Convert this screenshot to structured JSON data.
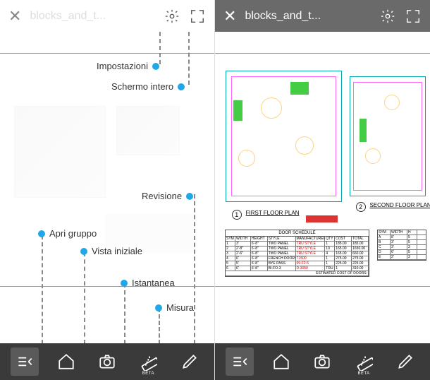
{
  "left": {
    "title": "blocks_and_t...",
    "callouts": {
      "settings": "Impostazioni",
      "fullscreen": "Schermo intero",
      "open_group": "Apri gruppo",
      "initial_view": "Vista iniziale",
      "snapshot": "Istantanea",
      "revision": "Revisione",
      "measure": "Misura"
    }
  },
  "right": {
    "title": "blocks_and_t...",
    "plans": {
      "first_num": "1",
      "first_label": "FIRST FLOOR PLAN",
      "second_num": "2",
      "second_label": "SECOND FLOOR PLAN"
    },
    "schedule": {
      "title": "DOOR SCHEDULE",
      "headers": [
        "SYM",
        "WIDTH",
        "HEIGHT",
        "STYLE",
        "MANUFACTURER",
        "QTY",
        "COST",
        "TOTAL"
      ],
      "rows": [
        [
          "1",
          "3'",
          "6'-8\"",
          "TWO PANEL",
          "TRU STYLE",
          "1",
          "185.00",
          "185.00"
        ],
        [
          "2",
          "2'-8\"",
          "6'-8\"",
          "TWO PANEL",
          "TRU STYLE",
          "10",
          "165.00",
          "1650.00"
        ],
        [
          "3",
          "2'-6\"",
          "6'-8\"",
          "TWO PANEL",
          "TRU STYLE",
          "4",
          "165.00",
          "660.00"
        ],
        [
          "4",
          "6'",
          "6'-8\"",
          "FRENCH DOORS",
          "T1500",
          "1",
          "275.00",
          "275.00"
        ],
        [
          "5",
          "5'",
          "6'-8\"",
          "BYE PASS",
          "69-F2-5",
          "1",
          "225.00",
          "225.00"
        ],
        [
          "6",
          "6'",
          "6'-8\"",
          "BI-FO-3",
          "D-3050",
          "TRU STYLE",
          "1",
          "310.00"
        ]
      ],
      "footer": "ESTIMATED COST OF DOORS:"
    },
    "schedule2": {
      "headers": [
        "SYM",
        "WIDTH",
        "H"
      ],
      "rows": [
        [
          "A",
          "8'",
          "5"
        ],
        [
          "B",
          "3'",
          "5"
        ],
        [
          "C",
          "3'",
          "3"
        ],
        [
          "D",
          "6'",
          "5"
        ],
        [
          "E",
          "2'",
          "3"
        ]
      ]
    }
  },
  "bottombar": {
    "beta": "BETA"
  }
}
